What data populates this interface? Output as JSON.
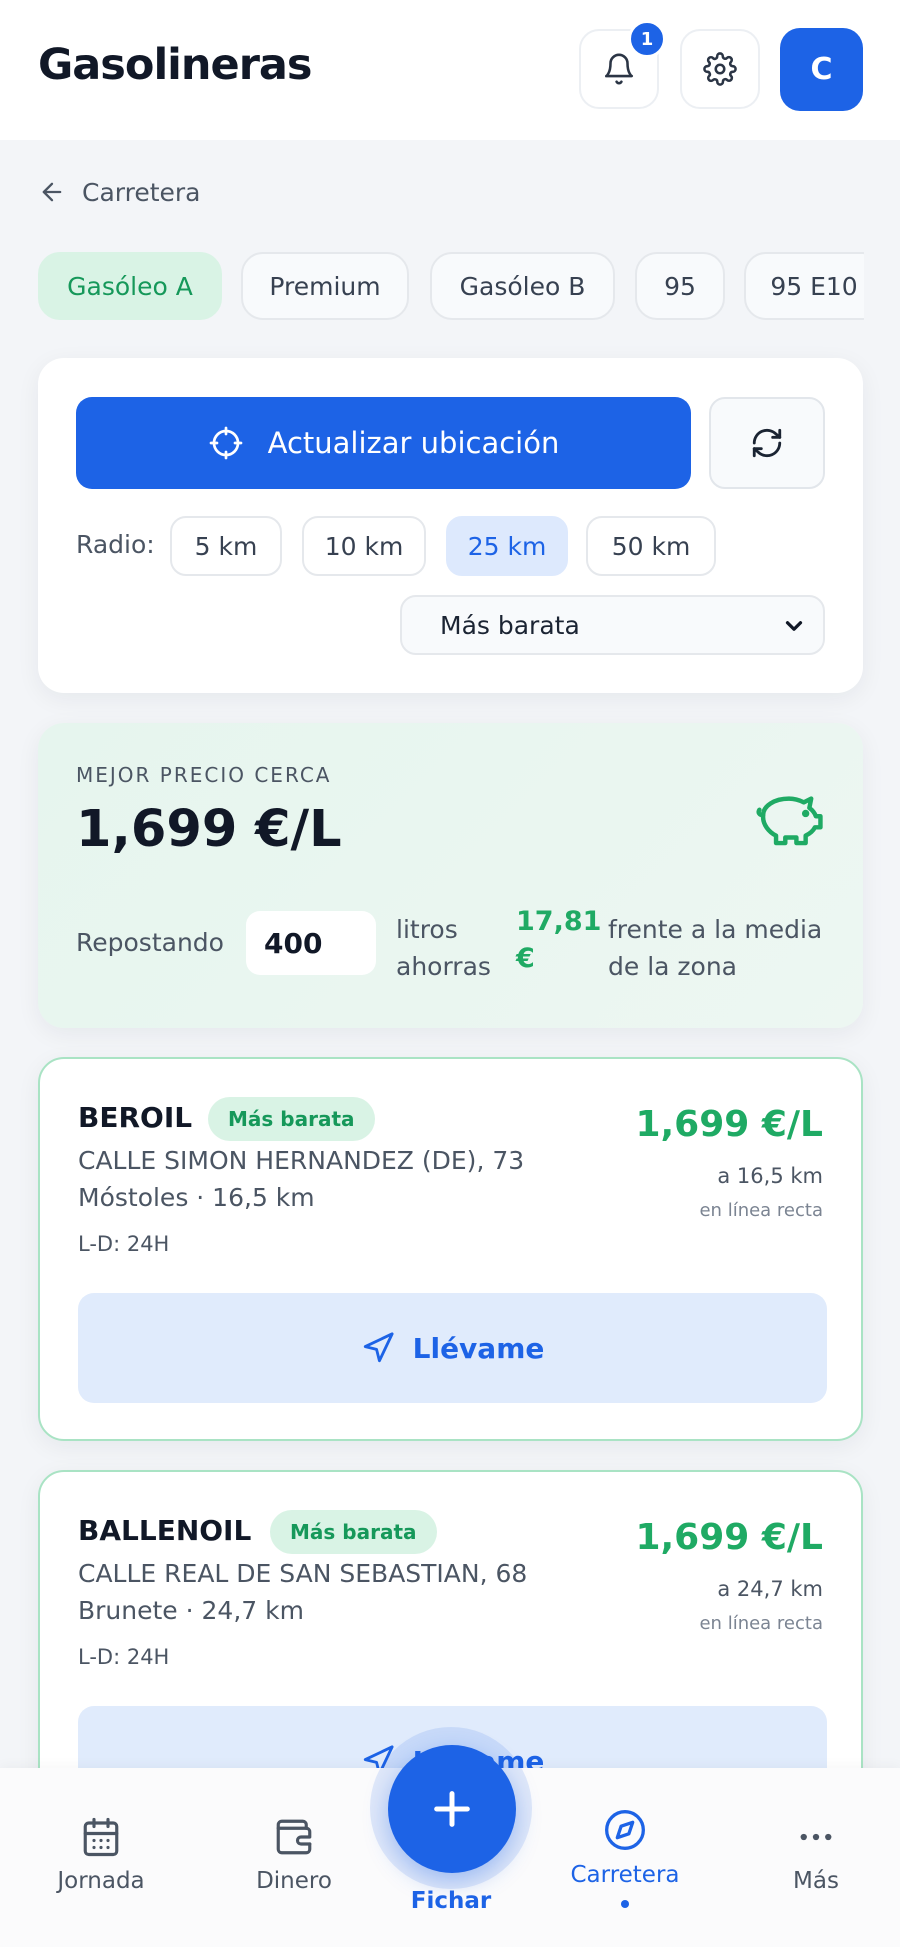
{
  "header": {
    "title": "Gasolineras",
    "notifications_count": "1",
    "avatar_initial": "C"
  },
  "breadcrumb": {
    "label": "Carretera"
  },
  "fuel_types": [
    {
      "label": "Gasóleo A",
      "active": true
    },
    {
      "label": "Premium",
      "active": false
    },
    {
      "label": "Gasóleo B",
      "active": false
    },
    {
      "label": "95",
      "active": false
    },
    {
      "label": "95 E10",
      "active": false
    }
  ],
  "location": {
    "update_label": "Actualizar ubicación",
    "radius_label": "Radio:",
    "radius_options": [
      "5 km",
      "10 km",
      "25 km",
      "50 km"
    ],
    "radius_selected": "25 km",
    "sort_selected": "Más barata"
  },
  "best": {
    "label": "MEJOR PRECIO CERCA",
    "price": "1,699 €/L",
    "repostando_label": "Repostando",
    "litros": "400",
    "litros_label": "litros ahorras",
    "savings": "17,81 €",
    "compare_label": "frente a la media de la zona"
  },
  "stations": [
    {
      "name": "BEROIL",
      "badge": "Más barata",
      "address": "CALLE SIMON HERNANDEZ (DE), 73",
      "city": "Móstoles · 16,5 km",
      "hours": "L-D: 24H",
      "price": "1,699 €/L",
      "distance": "a 16,5 km",
      "note": "en línea recta",
      "go_label": "Llévame"
    },
    {
      "name": "BALLENOIL",
      "badge": "Más barata",
      "address": "CALLE REAL DE SAN SEBASTIAN, 68",
      "city": "Brunete · 24,7 km",
      "hours": "L-D: 24H",
      "price": "1,699 €/L",
      "distance": "a 24,7 km",
      "note": "en línea recta",
      "go_label": "Llévame"
    }
  ],
  "nav": {
    "items": [
      "Jornada",
      "Dinero",
      "Fichar",
      "Carretera",
      "Más"
    ],
    "active": "Carretera"
  },
  "colors": {
    "accent": "#1d63e6",
    "success": "#1faa64",
    "success_bg": "#d9f3e5"
  }
}
